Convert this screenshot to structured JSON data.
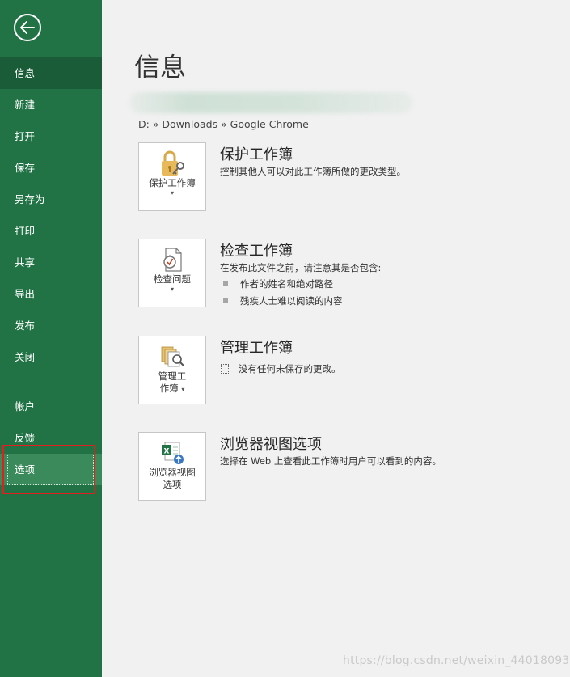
{
  "sidebar": {
    "back_icon": "back-arrow-icon",
    "items": [
      {
        "label": "信息"
      },
      {
        "label": "新建"
      },
      {
        "label": "打开"
      },
      {
        "label": "保存"
      },
      {
        "label": "另存为"
      },
      {
        "label": "打印"
      },
      {
        "label": "共享"
      },
      {
        "label": "导出"
      },
      {
        "label": "发布"
      },
      {
        "label": "关闭"
      },
      {
        "label": "帐户"
      },
      {
        "label": "反馈"
      },
      {
        "label": "选项"
      }
    ],
    "selected": "信息",
    "highlighted": "选项"
  },
  "main": {
    "title": "信息",
    "path": "D: » Downloads » Google Chrome",
    "sections": [
      {
        "button_label": "保护工作簿",
        "button_icon": "lock-key-icon",
        "title": "保护工作簿",
        "description": "控制其他人可以对此工作簿所做的更改类型。"
      },
      {
        "button_label": "检查问题",
        "button_icon": "inspect-document-icon",
        "title": "检查工作簿",
        "description": "在发布此文件之前，请注意其是否包含:",
        "bullets": [
          "作者的姓名和绝对路径",
          "残疾人士难以阅读的内容"
        ]
      },
      {
        "button_label_line1": "管理工",
        "button_label_line2": "作簿",
        "button_icon": "manage-workbook-icon",
        "title": "管理工作簿",
        "status": "没有任何未保存的更改。"
      },
      {
        "button_label_line1": "浏览器视图",
        "button_label_line2": "选项",
        "button_icon": "browser-view-icon",
        "title": "浏览器视图选项",
        "description": "选择在 Web 上查看此工作簿时用户可以看到的内容。"
      }
    ]
  },
  "watermark": "https://blog.csdn.net/weixin_44018093",
  "colors": {
    "sidebar_bg": "#217346",
    "sidebar_selected": "#1a5c38",
    "main_bg": "#f1f1f1",
    "highlight_outline": "#e01f1f"
  }
}
